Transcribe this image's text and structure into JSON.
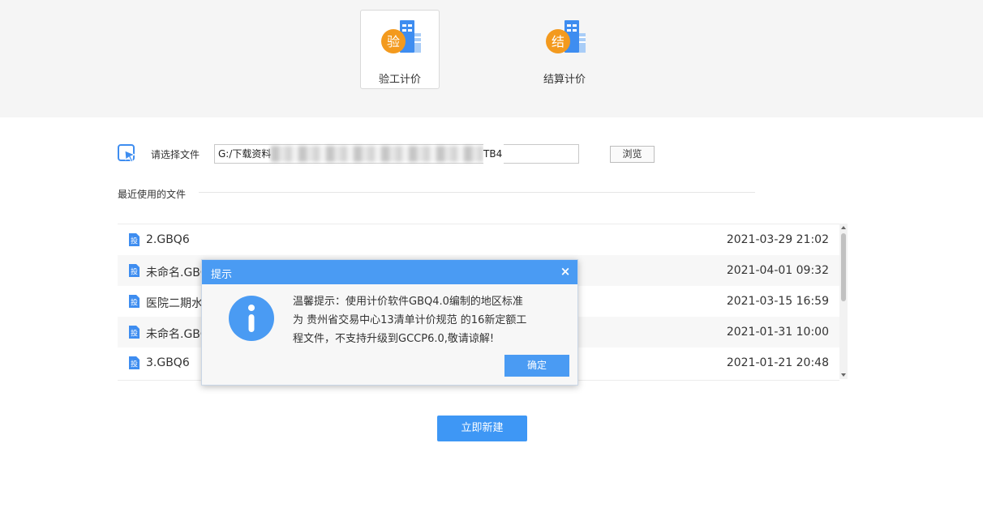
{
  "modes": [
    {
      "label": "验工计价",
      "badge": "验",
      "active": true
    },
    {
      "label": "结算计价",
      "badge": "结",
      "active": false
    }
  ],
  "file_select": {
    "label": "请选择文件",
    "path_prefix": "G:/下载资料",
    "path_suffix": "TB4",
    "browse_label": "浏览"
  },
  "recent": {
    "title": "最近使用的文件",
    "file_icon_glyph": "投",
    "files": [
      {
        "name": "2.GBQ6",
        "date": "2021-03-29 21:02"
      },
      {
        "name": "未命名.GBQ",
        "date": "2021-04-01 09:32"
      },
      {
        "name": "医院二期水",
        "date": "2021-03-15 16:59"
      },
      {
        "name": "未命名.GBQ",
        "date": "2021-01-31 10:00"
      },
      {
        "name": "3.GBQ6",
        "date": "2021-01-21 20:48"
      }
    ]
  },
  "create_button": "立即新建",
  "dialog": {
    "title": "提示",
    "close_glyph": "×",
    "message_lines": [
      "温馨提示：使用计价软件GBQ4.0编制的地区标准",
      "为 贵州省交易中心13清单计价规范 的16新定额工",
      "程文件，不支持升级到GCCP6.0,敬请谅解!"
    ],
    "ok_label": "确定"
  },
  "colors": {
    "accent": "#3e97f5",
    "dialog_header": "#4a9bf3",
    "badge_orange": "#f39a1e"
  }
}
